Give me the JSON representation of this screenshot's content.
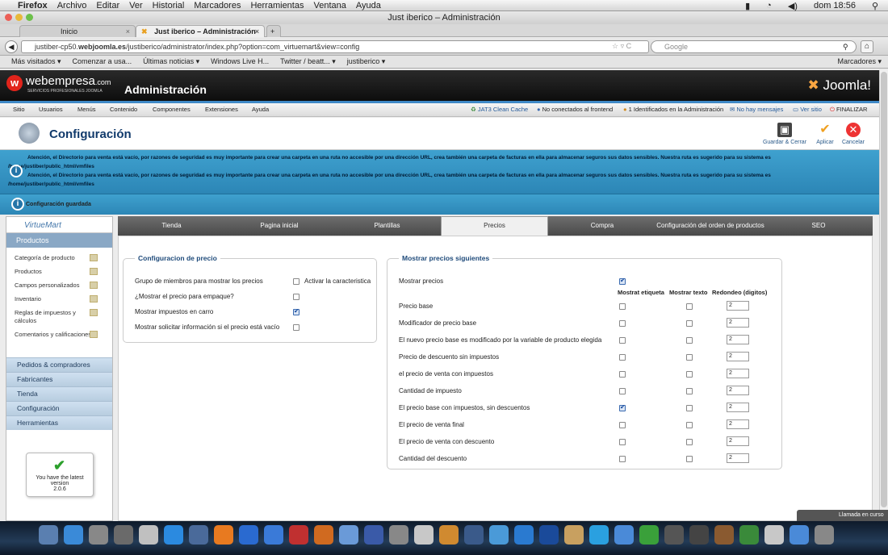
{
  "mac": {
    "app": "Firefox",
    "menus": [
      "Archivo",
      "Editar",
      "Ver",
      "Historial",
      "Marcadores",
      "Herramientas",
      "Ventana",
      "Ayuda"
    ],
    "clock": "dom 18:56"
  },
  "window_title": "Just iberico – Administración",
  "tabs": [
    {
      "label": "Inicio"
    },
    {
      "label": "Just iberico – Administración"
    }
  ],
  "url": {
    "prefix": "justiber-cp50.",
    "domain": "webjoomla.es",
    "path": "/justiberico/administrator/index.php?option=com_virtuemart&view=config"
  },
  "search": {
    "placeholder": "Google"
  },
  "bookmarks": [
    "Más visitados ▾",
    "Comenzar a usa...",
    "Últimas noticias ▾",
    "Windows Live H...",
    "Twitter / beatt... ▾",
    "justiberico ▾"
  ],
  "bookmarks_right": "Marcadores ▾",
  "joomla": {
    "brand": "webempresa",
    "brand_suffix": ".com",
    "brand_sub": "SERVICIOS PROFESIONALES JOOMLA",
    "admin_title": "Administración",
    "logo": "Joomla!",
    "menu": [
      "Sitio",
      "Usuarios",
      "Menús",
      "Contenido",
      "Componentes",
      "Extensiones",
      "Ayuda"
    ],
    "status": {
      "cache": "JAT3 Clean Cache",
      "frontend": "No conectados al frontend",
      "admin": "1 Identificados en la Administración",
      "messages": "No hay mensajes",
      "view": "Ver sitio",
      "logout": "FINALIZAR"
    }
  },
  "toolbar": {
    "title": "Configuración",
    "save_close": "Guardar & Cerrar",
    "apply": "Aplicar",
    "cancel": "Cancelar"
  },
  "alert": {
    "line1": "Atención, el Directorio para venta está vacío, por razones de seguridad es muy importante para crear una carpeta en una ruta no accesible por una dirección URL, crea también una carpeta de facturas en ella para almacenar seguros sus datos sensibles. Nuestra ruta es sugerido para su sistema es /home/justiber/public_html/vmfiles",
    "line2": "Atención, el Directorio para venta está vacío, por razones de seguridad es muy importante para crear una carpeta en una ruta no accesible por una dirección URL, crea también una carpeta de facturas en ella para almacenar seguros sus datos sensibles. Nuestra ruta es sugerido para su sistema es /home/justiber/public_html/vmfiles",
    "saved": "Configuración guardada"
  },
  "sidebar": {
    "logo": "VirtueMart",
    "section": "Productos",
    "items": [
      "Categoría de producto",
      "Productos",
      "Campos personalizados",
      "Inventario",
      "Reglas de impuestos y cálculos",
      "Comentarios y calificaciones"
    ],
    "bars": [
      "Pedidos & compradores",
      "Fabricantes",
      "Tienda",
      "Configuración",
      "Herramientas"
    ],
    "version_line1": "You have the latest",
    "version_line2": "version",
    "version": "2.0.6"
  },
  "config_tabs": [
    {
      "label": "Tienda"
    },
    {
      "label": "Pagina inicial"
    },
    {
      "label": "Plantillas"
    },
    {
      "label": "Precios"
    },
    {
      "label": "Compra"
    },
    {
      "label": "Configuración del orden de productos"
    },
    {
      "label": "SEO"
    }
  ],
  "config_precio": {
    "legend": "Configuracion de precio",
    "rows": [
      {
        "label": "Grupo de miembros para mostrar los precios",
        "checked": false,
        "extra": "Activar la caracteristica"
      },
      {
        "label": "¿Mostrar el precio para empaque?",
        "checked": false
      },
      {
        "label": "Mostrar impuestos en carro",
        "checked": true
      },
      {
        "label": "Mostrar solicitar información si el precio está vacío",
        "checked": false
      }
    ]
  },
  "mostrar": {
    "legend": "Mostrar precios siguientes",
    "show_label": "Mostrar precios",
    "show_checked": true,
    "col_label": "Mostrat etiqueta",
    "col_text": "Mostrar texto",
    "col_round": "Redondeo (digitos)",
    "rows": [
      {
        "label": "Precio base",
        "label_on": false,
        "text_on": false,
        "round": "2"
      },
      {
        "label": "Modificador de precio base",
        "label_on": false,
        "text_on": false,
        "round": "2"
      },
      {
        "label": "El nuevo precio base es modificado por la variable de producto elegida",
        "label_on": false,
        "text_on": false,
        "round": "2"
      },
      {
        "label": "Precio de descuento sin impuestos",
        "label_on": false,
        "text_on": false,
        "round": "2"
      },
      {
        "label": "el precio de venta con impuestos",
        "label_on": false,
        "text_on": false,
        "round": "2"
      },
      {
        "label": "Cantidad de impuesto",
        "label_on": false,
        "text_on": false,
        "round": "2"
      },
      {
        "label": "El precio base con impuestos, sin descuentos",
        "label_on": true,
        "text_on": false,
        "round": "2"
      },
      {
        "label": "El precio de venta final",
        "label_on": false,
        "text_on": false,
        "round": "2"
      },
      {
        "label": "El precio de venta con descuento",
        "label_on": false,
        "text_on": false,
        "round": "2"
      },
      {
        "label": "Cantidad del descuento",
        "label_on": false,
        "text_on": false,
        "round": "2"
      }
    ]
  },
  "notification": "Llamada en curso"
}
